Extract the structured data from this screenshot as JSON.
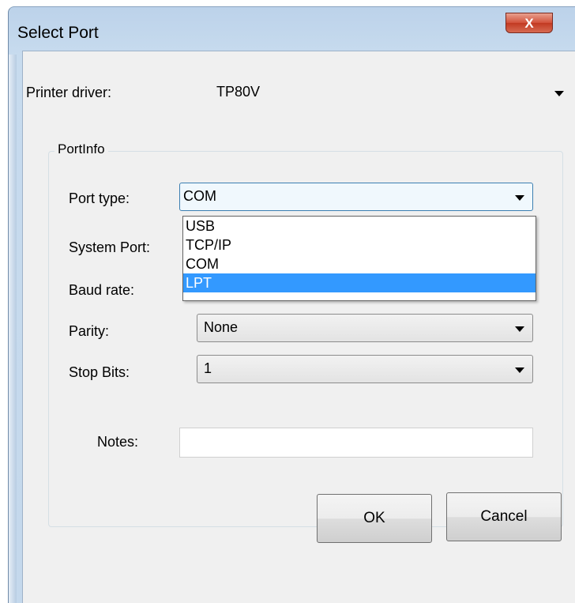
{
  "window": {
    "title": "Select Port",
    "close_glyph": "X"
  },
  "printer_driver": {
    "label": "Printer driver:",
    "value": "TP80V"
  },
  "port_info": {
    "group_title": "PortInfo",
    "port_type": {
      "label": "Port type:",
      "value": "COM",
      "options": [
        "USB",
        "TCP/IP",
        "COM",
        "LPT"
      ],
      "highlighted": "LPT"
    },
    "system_port": {
      "label": "System Port:"
    },
    "baud_rate": {
      "label": "Baud rate:"
    },
    "parity": {
      "label": "Parity:",
      "value": "None"
    },
    "stop_bits": {
      "label": "Stop Bits:",
      "value": "1"
    },
    "notes": {
      "label": "Notes:",
      "value": ""
    }
  },
  "buttons": {
    "ok": "OK",
    "cancel": "Cancel"
  },
  "colors": {
    "highlight": "#3399ff",
    "close_button": "#c23a22",
    "dialog_bg": "#f0f0f0"
  },
  "icons": {
    "close": "close-icon",
    "dropdown_arrow": "chevron-down-icon"
  }
}
